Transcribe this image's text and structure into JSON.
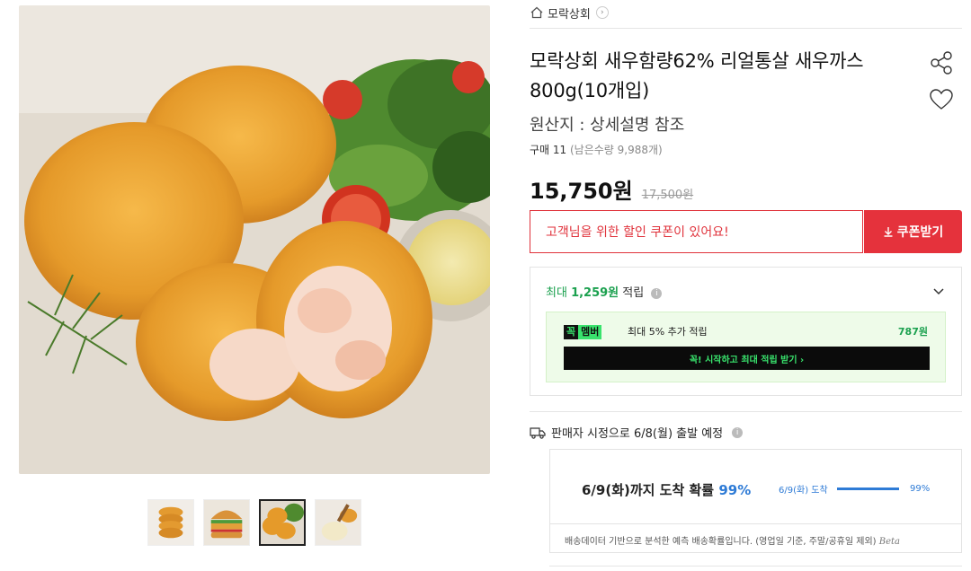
{
  "brand": {
    "name": "모락상회",
    "icon": "home-icon"
  },
  "product": {
    "title": "모락상회 새우함량62% 리얼통살 새우까스 800g(10개입)",
    "origin": "원산지 : 상세설명 참조",
    "buy_label": "구매 11",
    "remaining": "(남은수량 9,988개)",
    "price": "15,750원",
    "original_price": "17,500원"
  },
  "coupon": {
    "message": "고객님을 위한 할인 쿠폰이 있어요!",
    "button_label": "쿠폰받기"
  },
  "reward": {
    "prefix": "최대",
    "amount": "1,259원",
    "suffix": "적립",
    "member_badge_k": "꼭",
    "member_badge_m": "멤버",
    "member_text": "최대 5% 추가 적립",
    "member_amount": "787원",
    "member_button": "꼭! 시작하고 최대 적립 받기 ›"
  },
  "shipping": {
    "headline": "판매자 시정으로 6/8(월) 출발 예정",
    "arrival_main": "6/9(화)까지 도착 확률",
    "arrival_pct": "99%",
    "side_date": "6/9(화) 도착",
    "side_pct": "99%",
    "side_probability": 0.99,
    "note": "배송데이터 기반으로 분석한 예측 배송확률입니다. (영업일 기준, 주말/공휴일 제외)",
    "beta": "Beta"
  },
  "thumbnails": [
    "stacked-cutlets",
    "burger",
    "cutlets-salad",
    "sauce-dip"
  ],
  "colors": {
    "accent_red": "#e5323c",
    "green": "#1aa04e",
    "blue": "#2e7bd6"
  }
}
